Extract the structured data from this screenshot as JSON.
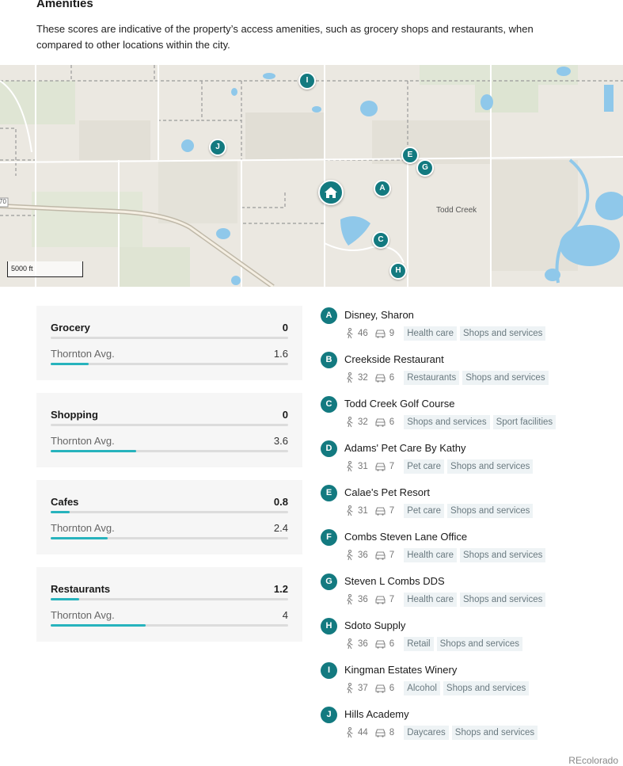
{
  "section": {
    "title": "Amenities",
    "description": "These scores are indicative of the property’s access amenities, such as grocery shops and restaurants, when compared to other locations within the city."
  },
  "map": {
    "place_label": "Todd Creek",
    "scale_label": "5000 ft",
    "road_label": "70",
    "pins": [
      "A",
      "C",
      "E",
      "G",
      "H",
      "I",
      "J"
    ]
  },
  "scores": [
    {
      "category": "Grocery",
      "value": "0",
      "value_num": 0,
      "avg_label": "Thornton Avg.",
      "avg": "1.6",
      "avg_num": 1.6
    },
    {
      "category": "Shopping",
      "value": "0",
      "value_num": 0,
      "avg_label": "Thornton Avg.",
      "avg": "3.6",
      "avg_num": 3.6
    },
    {
      "category": "Cafes",
      "value": "0.8",
      "value_num": 0.8,
      "avg_label": "Thornton Avg.",
      "avg": "2.4",
      "avg_num": 2.4
    },
    {
      "category": "Restaurants",
      "value": "1.2",
      "value_num": 1.2,
      "avg_label": "Thornton Avg.",
      "avg": "4",
      "avg_num": 4
    }
  ],
  "score_max": 10,
  "amenities": [
    {
      "letter": "A",
      "name": "Disney, Sharon",
      "walk": "46",
      "drive": "9",
      "tags": [
        "Health care",
        "Shops and services"
      ]
    },
    {
      "letter": "B",
      "name": "Creekside Restaurant",
      "walk": "32",
      "drive": "6",
      "tags": [
        "Restaurants",
        "Shops and services"
      ]
    },
    {
      "letter": "C",
      "name": "Todd Creek Golf Course",
      "walk": "32",
      "drive": "6",
      "tags": [
        "Shops and services",
        "Sport facilities"
      ]
    },
    {
      "letter": "D",
      "name": "Adams' Pet Care By Kathy",
      "walk": "31",
      "drive": "7",
      "tags": [
        "Pet care",
        "Shops and services"
      ]
    },
    {
      "letter": "E",
      "name": "Calae's Pet Resort",
      "walk": "31",
      "drive": "7",
      "tags": [
        "Pet care",
        "Shops and services"
      ]
    },
    {
      "letter": "F",
      "name": "Combs Steven Lane Office",
      "walk": "36",
      "drive": "7",
      "tags": [
        "Health care",
        "Shops and services"
      ]
    },
    {
      "letter": "G",
      "name": "Steven L Combs DDS",
      "walk": "36",
      "drive": "7",
      "tags": [
        "Health care",
        "Shops and services"
      ]
    },
    {
      "letter": "H",
      "name": "Sdoto Supply",
      "walk": "36",
      "drive": "6",
      "tags": [
        "Retail",
        "Shops and services"
      ]
    },
    {
      "letter": "I",
      "name": "Kingman Estates Winery",
      "walk": "37",
      "drive": "6",
      "tags": [
        "Alcohol",
        "Shops and services"
      ]
    },
    {
      "letter": "J",
      "name": "Hills Academy",
      "walk": "44",
      "drive": "8",
      "tags": [
        "Daycares",
        "Shops and services"
      ]
    }
  ],
  "footer": {
    "source": "REcolorado"
  }
}
